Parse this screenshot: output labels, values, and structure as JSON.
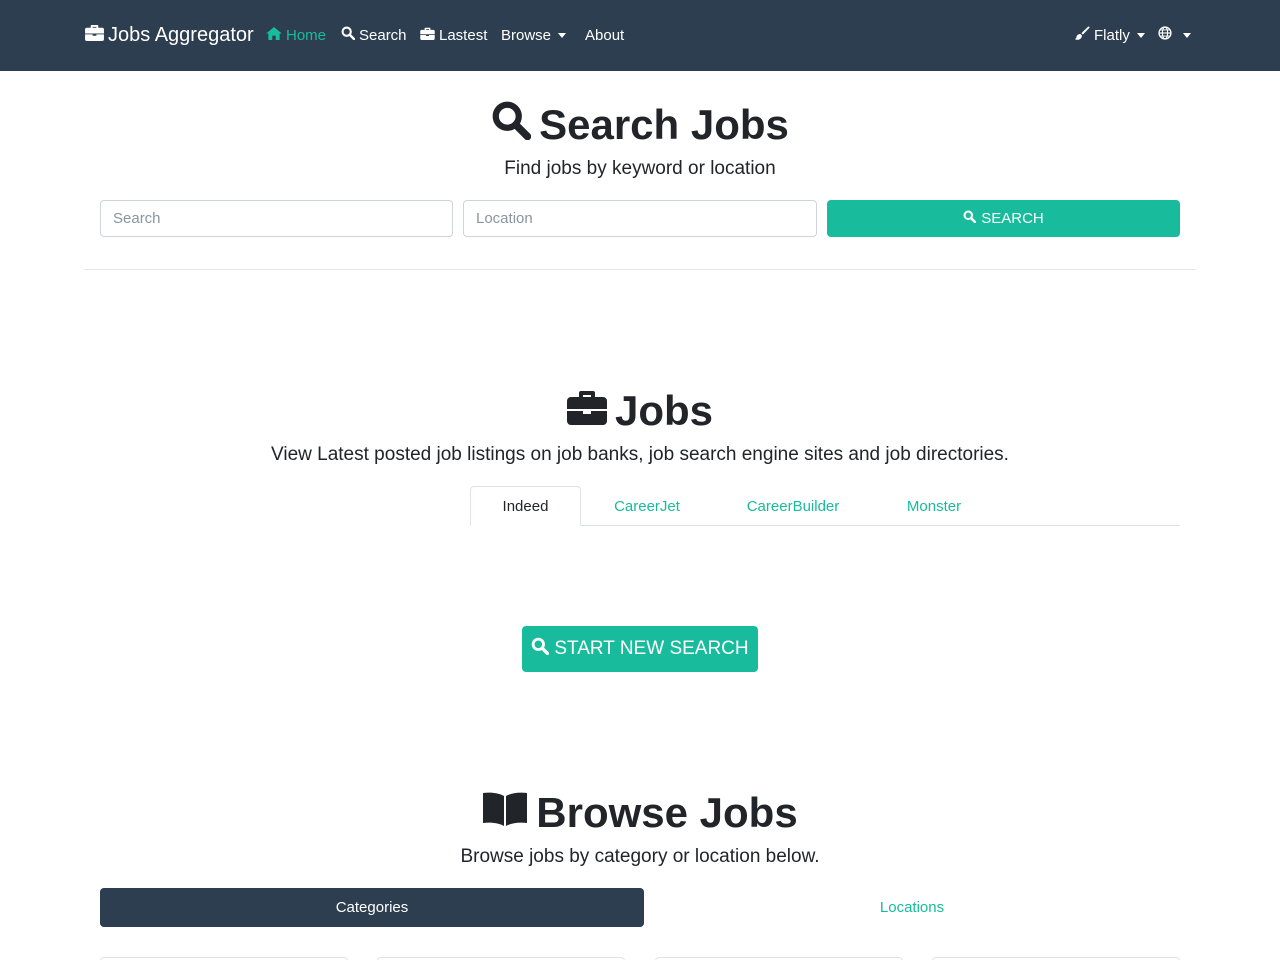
{
  "navbar": {
    "brand": "Jobs Aggregator",
    "items": [
      {
        "label": "Home",
        "icon": "home-icon",
        "active": true
      },
      {
        "label": "Search",
        "icon": "search-icon"
      },
      {
        "label": "Lastest",
        "icon": "briefcase-icon"
      },
      {
        "label": "Browse",
        "dropdown": true
      },
      {
        "label": "About"
      }
    ],
    "theme_label": "Flatly",
    "language_icon": "globe-icon"
  },
  "search_section": {
    "title": "Search Jobs",
    "subtitle": "Find jobs by keyword or location",
    "search_placeholder": "Search",
    "location_placeholder": "Location",
    "button_label": "SEARCH"
  },
  "jobs_section": {
    "title": "Jobs",
    "subtitle": "View Latest posted job listings on job banks, job search engine sites and job directories.",
    "tabs": [
      "Indeed",
      "CareerJet",
      "CareerBuilder",
      "Monster"
    ],
    "active_tab": "Indeed",
    "button_label": "START NEW SEARCH"
  },
  "browse_section": {
    "title": "Browse Jobs",
    "subtitle": "Browse jobs by category or location below.",
    "pills": [
      "Categories",
      "Locations"
    ],
    "active_pill": "Categories"
  },
  "colors": {
    "navbar": "#2c3e50",
    "accent": "#18bc9c",
    "text": "#212529"
  }
}
